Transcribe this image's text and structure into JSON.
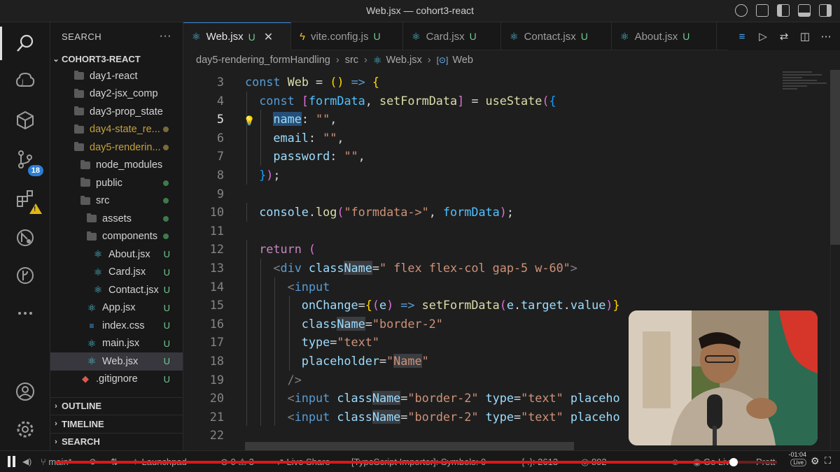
{
  "window": {
    "title": "Web.jsx — cohort3-react"
  },
  "activity_bar": {
    "scm_badge": "18"
  },
  "sidebar": {
    "header": "SEARCH",
    "more": "···",
    "project": "COHORT3-REACT",
    "tree": [
      {
        "name": "day1-react",
        "indent": 0,
        "kind": "folder"
      },
      {
        "name": "day2-jsx_comp",
        "indent": 0,
        "kind": "folder"
      },
      {
        "name": "day3-prop_state",
        "indent": 0,
        "kind": "folder"
      },
      {
        "name": "day4-state_re...",
        "indent": 0,
        "kind": "folder",
        "dot": "#7a6a3a",
        "modified": true
      },
      {
        "name": "day5-renderin...",
        "indent": 0,
        "kind": "folder",
        "dot": "#7a6a3a",
        "modified": true
      },
      {
        "name": "node_modules",
        "indent": 1,
        "kind": "folder"
      },
      {
        "name": "public",
        "indent": 1,
        "kind": "folder",
        "dot": "#3e7a4e"
      },
      {
        "name": "src",
        "indent": 1,
        "kind": "folder",
        "dot": "#3e7a4e"
      },
      {
        "name": "assets",
        "indent": 2,
        "kind": "folder",
        "dot": "#3e7a4e"
      },
      {
        "name": "components",
        "indent": 2,
        "kind": "folder",
        "dot": "#3e7a4e"
      },
      {
        "name": "About.jsx",
        "indent": 3,
        "kind": "react",
        "status": "U"
      },
      {
        "name": "Card.jsx",
        "indent": 3,
        "kind": "react",
        "status": "U"
      },
      {
        "name": "Contact.jsx",
        "indent": 3,
        "kind": "react",
        "status": "U"
      },
      {
        "name": "App.jsx",
        "indent": 2,
        "kind": "react",
        "status": "U"
      },
      {
        "name": "index.css",
        "indent": 2,
        "kind": "css",
        "status": "U"
      },
      {
        "name": "main.jsx",
        "indent": 2,
        "kind": "react",
        "status": "U"
      },
      {
        "name": "Web.jsx",
        "indent": 2,
        "kind": "react",
        "status": "U",
        "selected": true
      },
      {
        "name": ".gitignore",
        "indent": 1,
        "kind": "git",
        "status": "U"
      }
    ],
    "bottom_sections": [
      "OUTLINE",
      "TIMELINE",
      "SEARCH"
    ]
  },
  "tabs": [
    {
      "label": "Web.jsx",
      "status": "U",
      "icon": "react",
      "active": true
    },
    {
      "label": "vite.config.js",
      "status": "U",
      "icon": "bolt"
    },
    {
      "label": "Card.jsx",
      "status": "U",
      "icon": "react"
    },
    {
      "label": "Contact.jsx",
      "status": "U",
      "icon": "react"
    },
    {
      "label": "About.jsx",
      "status": "U",
      "icon": "react"
    }
  ],
  "breadcrumb": [
    "day5-rendering_formHandling",
    "src",
    "Web.jsx",
    "Web"
  ],
  "editor": {
    "current_line": 5,
    "lines": [
      {
        "n": "3",
        "indent": 0,
        "tokens": [
          [
            "k",
            "const "
          ],
          [
            "f",
            "Web"
          ],
          [
            "d",
            " = "
          ],
          [
            "p1",
            "()"
          ],
          [
            "d",
            " "
          ],
          [
            "k",
            "=>"
          ],
          [
            "d",
            " "
          ],
          [
            "p1",
            "{"
          ]
        ]
      },
      {
        "n": "4",
        "indent": 1,
        "tokens": [
          [
            "k",
            "const "
          ],
          [
            "p2",
            "["
          ],
          [
            "c",
            "formData"
          ],
          [
            "d",
            ", "
          ],
          [
            "f",
            "setFormData"
          ],
          [
            "p2",
            "]"
          ],
          [
            "d",
            " = "
          ],
          [
            "f",
            "useState"
          ],
          [
            "p2",
            "("
          ],
          [
            "p3",
            "{"
          ]
        ]
      },
      {
        "n": "5",
        "indent": 2,
        "tokens": [
          [
            "vh",
            "name"
          ],
          [
            "d",
            ": "
          ],
          [
            "s",
            "\"\""
          ],
          [
            "d",
            ","
          ]
        ]
      },
      {
        "n": "6",
        "indent": 2,
        "tokens": [
          [
            "v",
            "email"
          ],
          [
            "d",
            ": "
          ],
          [
            "s",
            "\"\""
          ],
          [
            "d",
            ","
          ]
        ]
      },
      {
        "n": "7",
        "indent": 2,
        "tokens": [
          [
            "v",
            "password"
          ],
          [
            "d",
            ": "
          ],
          [
            "s",
            "\"\""
          ],
          [
            "d",
            ","
          ]
        ]
      },
      {
        "n": "8",
        "indent": 1,
        "tokens": [
          [
            "p3",
            "}"
          ],
          [
            "p2",
            ")"
          ],
          [
            "d",
            ";"
          ]
        ]
      },
      {
        "n": "9",
        "indent": 0,
        "tokens": []
      },
      {
        "n": "10",
        "indent": 1,
        "tokens": [
          [
            "v",
            "console"
          ],
          [
            "d",
            "."
          ],
          [
            "f",
            "log"
          ],
          [
            "p2",
            "("
          ],
          [
            "s",
            "\"formdata->\""
          ],
          [
            "d",
            ", "
          ],
          [
            "c",
            "formData"
          ],
          [
            "p2",
            ")"
          ],
          [
            "d",
            ";"
          ]
        ]
      },
      {
        "n": "11",
        "indent": 0,
        "tokens": []
      },
      {
        "n": "12",
        "indent": 1,
        "tokens": [
          [
            "kc",
            "return "
          ],
          [
            "p2",
            "("
          ]
        ]
      },
      {
        "n": "13",
        "indent": 2,
        "tokens": [
          [
            "g",
            "<"
          ],
          [
            "t",
            "div"
          ],
          [
            "d",
            " "
          ],
          [
            "a",
            "class"
          ],
          [
            "ah",
            "Name"
          ],
          [
            "d",
            "="
          ],
          [
            "s",
            "\" flex flex-col gap-5 w-60\""
          ],
          [
            "g",
            ">"
          ]
        ]
      },
      {
        "n": "14",
        "indent": 3,
        "tokens": [
          [
            "g",
            "<"
          ],
          [
            "t",
            "input"
          ]
        ]
      },
      {
        "n": "15",
        "indent": 4,
        "tokens": [
          [
            "a",
            "onChange"
          ],
          [
            "d",
            "="
          ],
          [
            "p1",
            "{"
          ],
          [
            "p2",
            "("
          ],
          [
            "v",
            "e"
          ],
          [
            "p2",
            ")"
          ],
          [
            "d",
            " "
          ],
          [
            "k",
            "=>"
          ],
          [
            "d",
            " "
          ],
          [
            "f",
            "setFormData"
          ],
          [
            "p2",
            "("
          ],
          [
            "v",
            "e"
          ],
          [
            "d",
            "."
          ],
          [
            "v",
            "target"
          ],
          [
            "d",
            "."
          ],
          [
            "v",
            "value"
          ],
          [
            "p2",
            ")"
          ],
          [
            "p1",
            "}"
          ]
        ]
      },
      {
        "n": "16",
        "indent": 4,
        "tokens": [
          [
            "a",
            "class"
          ],
          [
            "ah",
            "Name"
          ],
          [
            "d",
            "="
          ],
          [
            "s",
            "\"border-2\""
          ]
        ]
      },
      {
        "n": "17",
        "indent": 4,
        "tokens": [
          [
            "a",
            "type"
          ],
          [
            "d",
            "="
          ],
          [
            "s",
            "\"text\""
          ]
        ]
      },
      {
        "n": "18",
        "indent": 4,
        "tokens": [
          [
            "a",
            "placeholder"
          ],
          [
            "d",
            "="
          ],
          [
            "s",
            "\""
          ],
          [
            "sh",
            "Name"
          ],
          [
            "s",
            "\""
          ]
        ]
      },
      {
        "n": "19",
        "indent": 3,
        "tokens": [
          [
            "g",
            "/>"
          ]
        ]
      },
      {
        "n": "20",
        "indent": 3,
        "tokens": [
          [
            "g",
            "<"
          ],
          [
            "t",
            "input"
          ],
          [
            "d",
            " "
          ],
          [
            "a",
            "class"
          ],
          [
            "ah",
            "Name"
          ],
          [
            "d",
            "="
          ],
          [
            "s",
            "\"border-2\""
          ],
          [
            "d",
            " "
          ],
          [
            "a",
            "type"
          ],
          [
            "d",
            "="
          ],
          [
            "s",
            "\"text\""
          ],
          [
            "d",
            " "
          ],
          [
            "a",
            "placeho"
          ]
        ]
      },
      {
        "n": "21",
        "indent": 3,
        "tokens": [
          [
            "g",
            "<"
          ],
          [
            "t",
            "input"
          ],
          [
            "d",
            " "
          ],
          [
            "a",
            "class"
          ],
          [
            "ah",
            "Name"
          ],
          [
            "d",
            "="
          ],
          [
            "s",
            "\"border-2\""
          ],
          [
            "d",
            " "
          ],
          [
            "a",
            "type"
          ],
          [
            "d",
            "="
          ],
          [
            "s",
            "\"text\""
          ],
          [
            "d",
            " "
          ],
          [
            "a",
            "placeho"
          ]
        ]
      },
      {
        "n": "22",
        "indent": 0,
        "tokens": []
      }
    ]
  },
  "statusbar": {
    "branch": "main*",
    "launchpad": "Launchpad",
    "problems_errors": "0",
    "problems_warnings": "3",
    "live_share": "Live Share",
    "ts_importer": "[TypeScript Importer]: Symbols: 0",
    "braces": "{ .}: 2613",
    "count": "892",
    "go_live": "Go Live",
    "prettier": "Prett",
    "video_time": "-01:04",
    "video_live": "Live",
    "video_progress": 0.94
  }
}
